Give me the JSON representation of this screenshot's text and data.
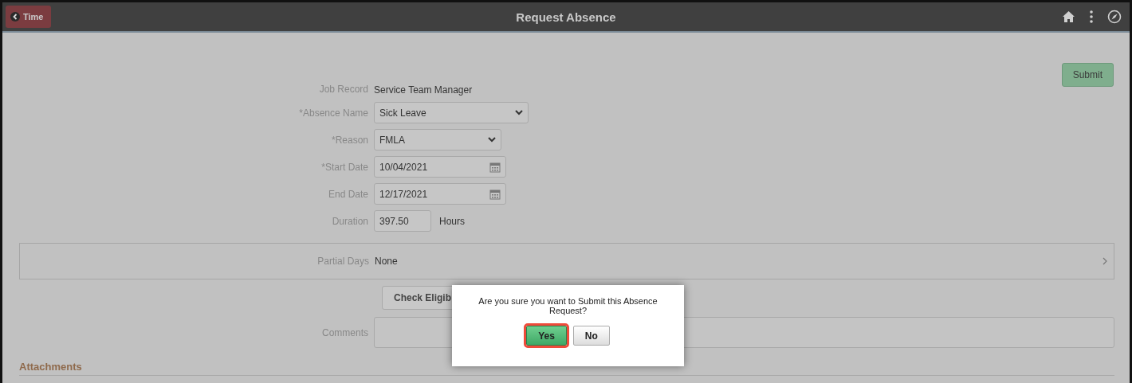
{
  "header": {
    "back_button": "Time",
    "title": "Request Absence"
  },
  "submit_button": "Submit",
  "fields": [
    {
      "kind": "text",
      "label": "Job Record",
      "value": "Service Team Manager"
    },
    {
      "kind": "select",
      "label": "*Absence Name",
      "value": "Sick Leave"
    },
    {
      "kind": "select",
      "label": "*Reason",
      "value": "FMLA"
    },
    {
      "kind": "date",
      "label": "*Start Date",
      "value": "10/04/2021"
    },
    {
      "kind": "date",
      "label": "End Date",
      "value": "12/17/2021"
    },
    {
      "kind": "number",
      "label": "Duration",
      "value": "397.50",
      "unit": "Hours"
    }
  ],
  "partial_days": {
    "label": "Partial Days",
    "value": "None"
  },
  "check_button": "Check Eligib",
  "comments": {
    "label": "Comments"
  },
  "attachments": {
    "title": "Attachments"
  },
  "dialog": {
    "message": "Are you sure you want to Submit this Absence Request?",
    "buttons": [
      {
        "label": "Yes",
        "kind": "primary",
        "highlighted": true
      },
      {
        "label": "No",
        "kind": "secondary",
        "highlighted": false
      }
    ]
  }
}
